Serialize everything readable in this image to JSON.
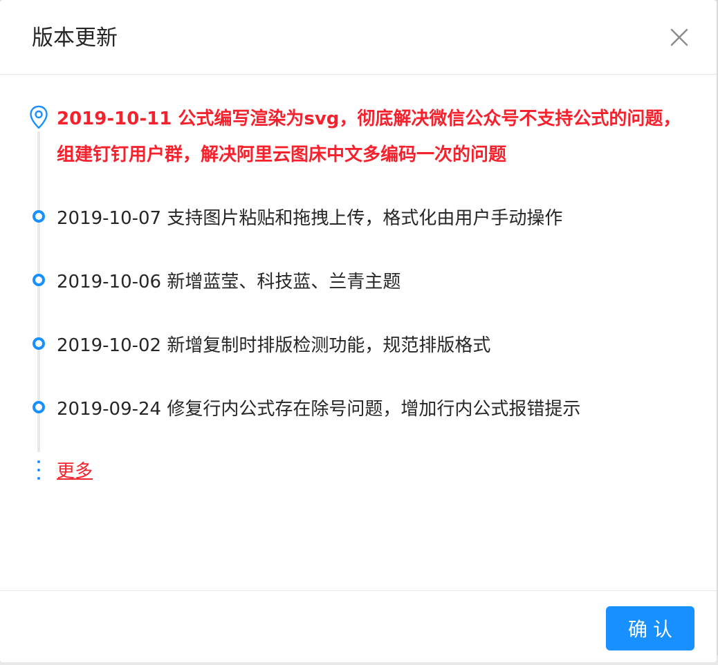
{
  "dialog": {
    "title": "版本更新",
    "close_icon": "close-icon"
  },
  "timeline": {
    "items": [
      {
        "text": "2019-10-11 公式编写渲染为svg，彻底解决微信公众号不支持公式的问题，组建钉钉用户群，解决阿里云图床中文多编码一次的问题",
        "highlight": true,
        "icon": "location-pin-icon"
      },
      {
        "text": "2019-10-07 支持图片粘贴和拖拽上传，格式化由用户手动操作",
        "highlight": false,
        "icon": "dot-icon"
      },
      {
        "text": "2019-10-06 新增蓝莹、科技蓝、兰青主题",
        "highlight": false,
        "icon": "dot-icon"
      },
      {
        "text": "2019-10-02 新增复制时排版检测功能，规范排版格式",
        "highlight": false,
        "icon": "dot-icon"
      },
      {
        "text": "2019-09-24 修复行内公式存在除号问题，增加行内公式报错提示",
        "highlight": false,
        "icon": "dot-icon"
      }
    ],
    "more_label": "更多"
  },
  "footer": {
    "ok_label": "确认"
  },
  "colors": {
    "accent": "#1890ff",
    "highlight": "#f5222d",
    "text": "#262626"
  }
}
